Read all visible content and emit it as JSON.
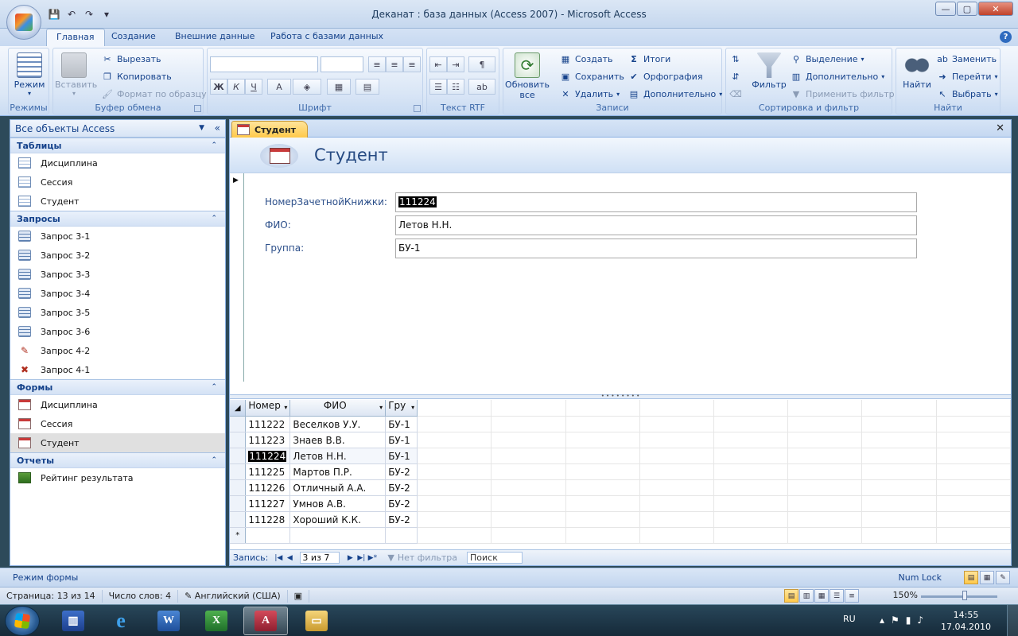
{
  "window": {
    "title": "Деканат : база данных (Access 2007)  -  Microsoft Access",
    "minimize": "—",
    "maximize": "▢",
    "close": "✕"
  },
  "tabs": [
    "Главная",
    "Создание",
    "Внешние данные",
    "Работа с базами данных"
  ],
  "help": "?",
  "ribbon": {
    "views": {
      "label": "Режимы",
      "view_button": "Режим"
    },
    "clipboard": {
      "label": "Буфер обмена",
      "paste": "Вставить",
      "cut": "Вырезать",
      "copy": "Копировать",
      "format_painter": "Формат по образцу"
    },
    "font": {
      "label": "Шрифт",
      "bold": "Ж",
      "italic": "К",
      "underline": "Ч",
      "font_color": "А"
    },
    "rtf": {
      "label": "Текст RTF"
    },
    "records": {
      "label": "Записи",
      "refresh": "Обновить",
      "refresh2": "все",
      "new": "Создать",
      "save": "Сохранить",
      "delete": "Удалить",
      "totals": "Итоги",
      "spelling": "Орфография",
      "more": "Дополнительно"
    },
    "sort_filter": {
      "label": "Сортировка и фильтр",
      "filter": "Фильтр",
      "selection": "Выделение",
      "advanced": "Дополнительно",
      "toggle_filter": "Применить фильтр"
    },
    "find": {
      "label": "Найти",
      "find": "Найти",
      "replace": "Заменить",
      "goto": "Перейти",
      "select": "Выбрать"
    }
  },
  "nav": {
    "header": "Все объекты Access",
    "sections": [
      {
        "title": "Таблицы",
        "items": [
          "Дисциплина",
          "Сессия",
          "Студент"
        ]
      },
      {
        "title": "Запросы",
        "items": [
          "Запрос 3-1",
          "Запрос 3-2",
          "Запрос 3-3",
          "Запрос 3-4",
          "Запрос 3-5",
          "Запрос 3-6",
          "Запрос 4-2",
          "Запрос 4-1"
        ]
      },
      {
        "title": "Формы",
        "items": [
          "Дисциплина",
          "Сессия",
          "Студент"
        ]
      },
      {
        "title": "Отчеты",
        "items": [
          "Рейтинг результата"
        ]
      }
    ]
  },
  "document": {
    "tab": "Студент",
    "form_title": "Студент",
    "fields": [
      {
        "label": "НомерЗачетнойКнижки:",
        "value": "111224"
      },
      {
        "label": "ФИО:",
        "value": "Летов Н.Н."
      },
      {
        "label": "Группа:",
        "value": "БУ-1"
      }
    ],
    "datasheet": {
      "columns": [
        "Номер",
        "ФИО",
        "Гру"
      ],
      "rows": [
        [
          "111222",
          "Веселков У.У.",
          "БУ-1"
        ],
        [
          "111223",
          "Знаев В.В.",
          "БУ-1"
        ],
        [
          "111224",
          "Летов Н.Н.",
          "БУ-1"
        ],
        [
          "111225",
          "Мартов П.Р.",
          "БУ-2"
        ],
        [
          "111226",
          "Отличный А.А.",
          "БУ-2"
        ],
        [
          "111227",
          "Умнов А.В.",
          "БУ-2"
        ],
        [
          "111228",
          "Хороший К.К.",
          "БУ-2"
        ]
      ],
      "new_row_marker": "*"
    },
    "record_nav": {
      "label": "Запись:",
      "position": "3 из 7",
      "filter": "Нет фильтра",
      "search": "Поиск"
    }
  },
  "status": {
    "mode": "Режим формы",
    "numlock": "Num Lock"
  },
  "word_status": {
    "page": "Страница: 13 из 14",
    "words": "Число слов: 4",
    "language": "Английский (США)",
    "zoom": "150%"
  },
  "taskbar": {
    "language": "RU",
    "time": "14:55",
    "date": "17.04.2010"
  },
  "colors": {
    "ribbon_text": "#15428b",
    "active_tab": "#ffc94a",
    "selection": "#000000"
  }
}
